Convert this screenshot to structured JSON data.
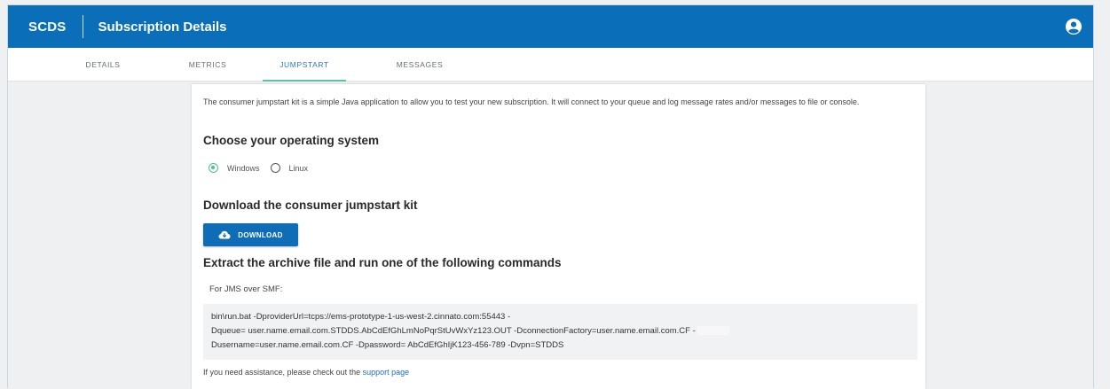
{
  "header": {
    "brand": "SCDS",
    "title": "Subscription Details",
    "colors": {
      "primary": "#0a6fb8",
      "accent": "#5fc1ab"
    }
  },
  "tabs": [
    {
      "label": "DETAILS",
      "active": false
    },
    {
      "label": "METRICS",
      "active": false
    },
    {
      "label": "JUMPSTART",
      "active": true
    },
    {
      "label": "MESSAGES",
      "active": false
    }
  ],
  "content": {
    "intro": "The consumer jumpstart kit is a simple Java application to allow you to test your new subscription. It will connect to your queue and log message rates and/or messages to file or console.",
    "os_heading": "Choose your operating system",
    "os_options": [
      {
        "label": "Windows",
        "selected": true
      },
      {
        "label": "Linux",
        "selected": false
      }
    ],
    "download_heading": "Download the consumer jumpstart kit",
    "download_button": "DOWNLOAD",
    "extract_heading": "Extract the archive file and run one of the following commands",
    "jms_label": "For JMS over SMF:",
    "command_lines": [
      "bin\\run.bat -DproviderUrl=tcps://ems-prototype-1-us-west-2.cinnato.com:55443 -",
      "Dqueue= user.name.email.com.STDDS.AbCdEfGhLmNoPqrStUvWxYz123.OUT -DconnectionFactory=user.name.email.com.CF -",
      "Dusername=user.name.email.com.CF -Dpassword= AbCdEfGhIjK123-456-789 -Dvpn=STDDS"
    ],
    "help_text": "If you need assistance, please check out the",
    "help_link": "support page"
  }
}
